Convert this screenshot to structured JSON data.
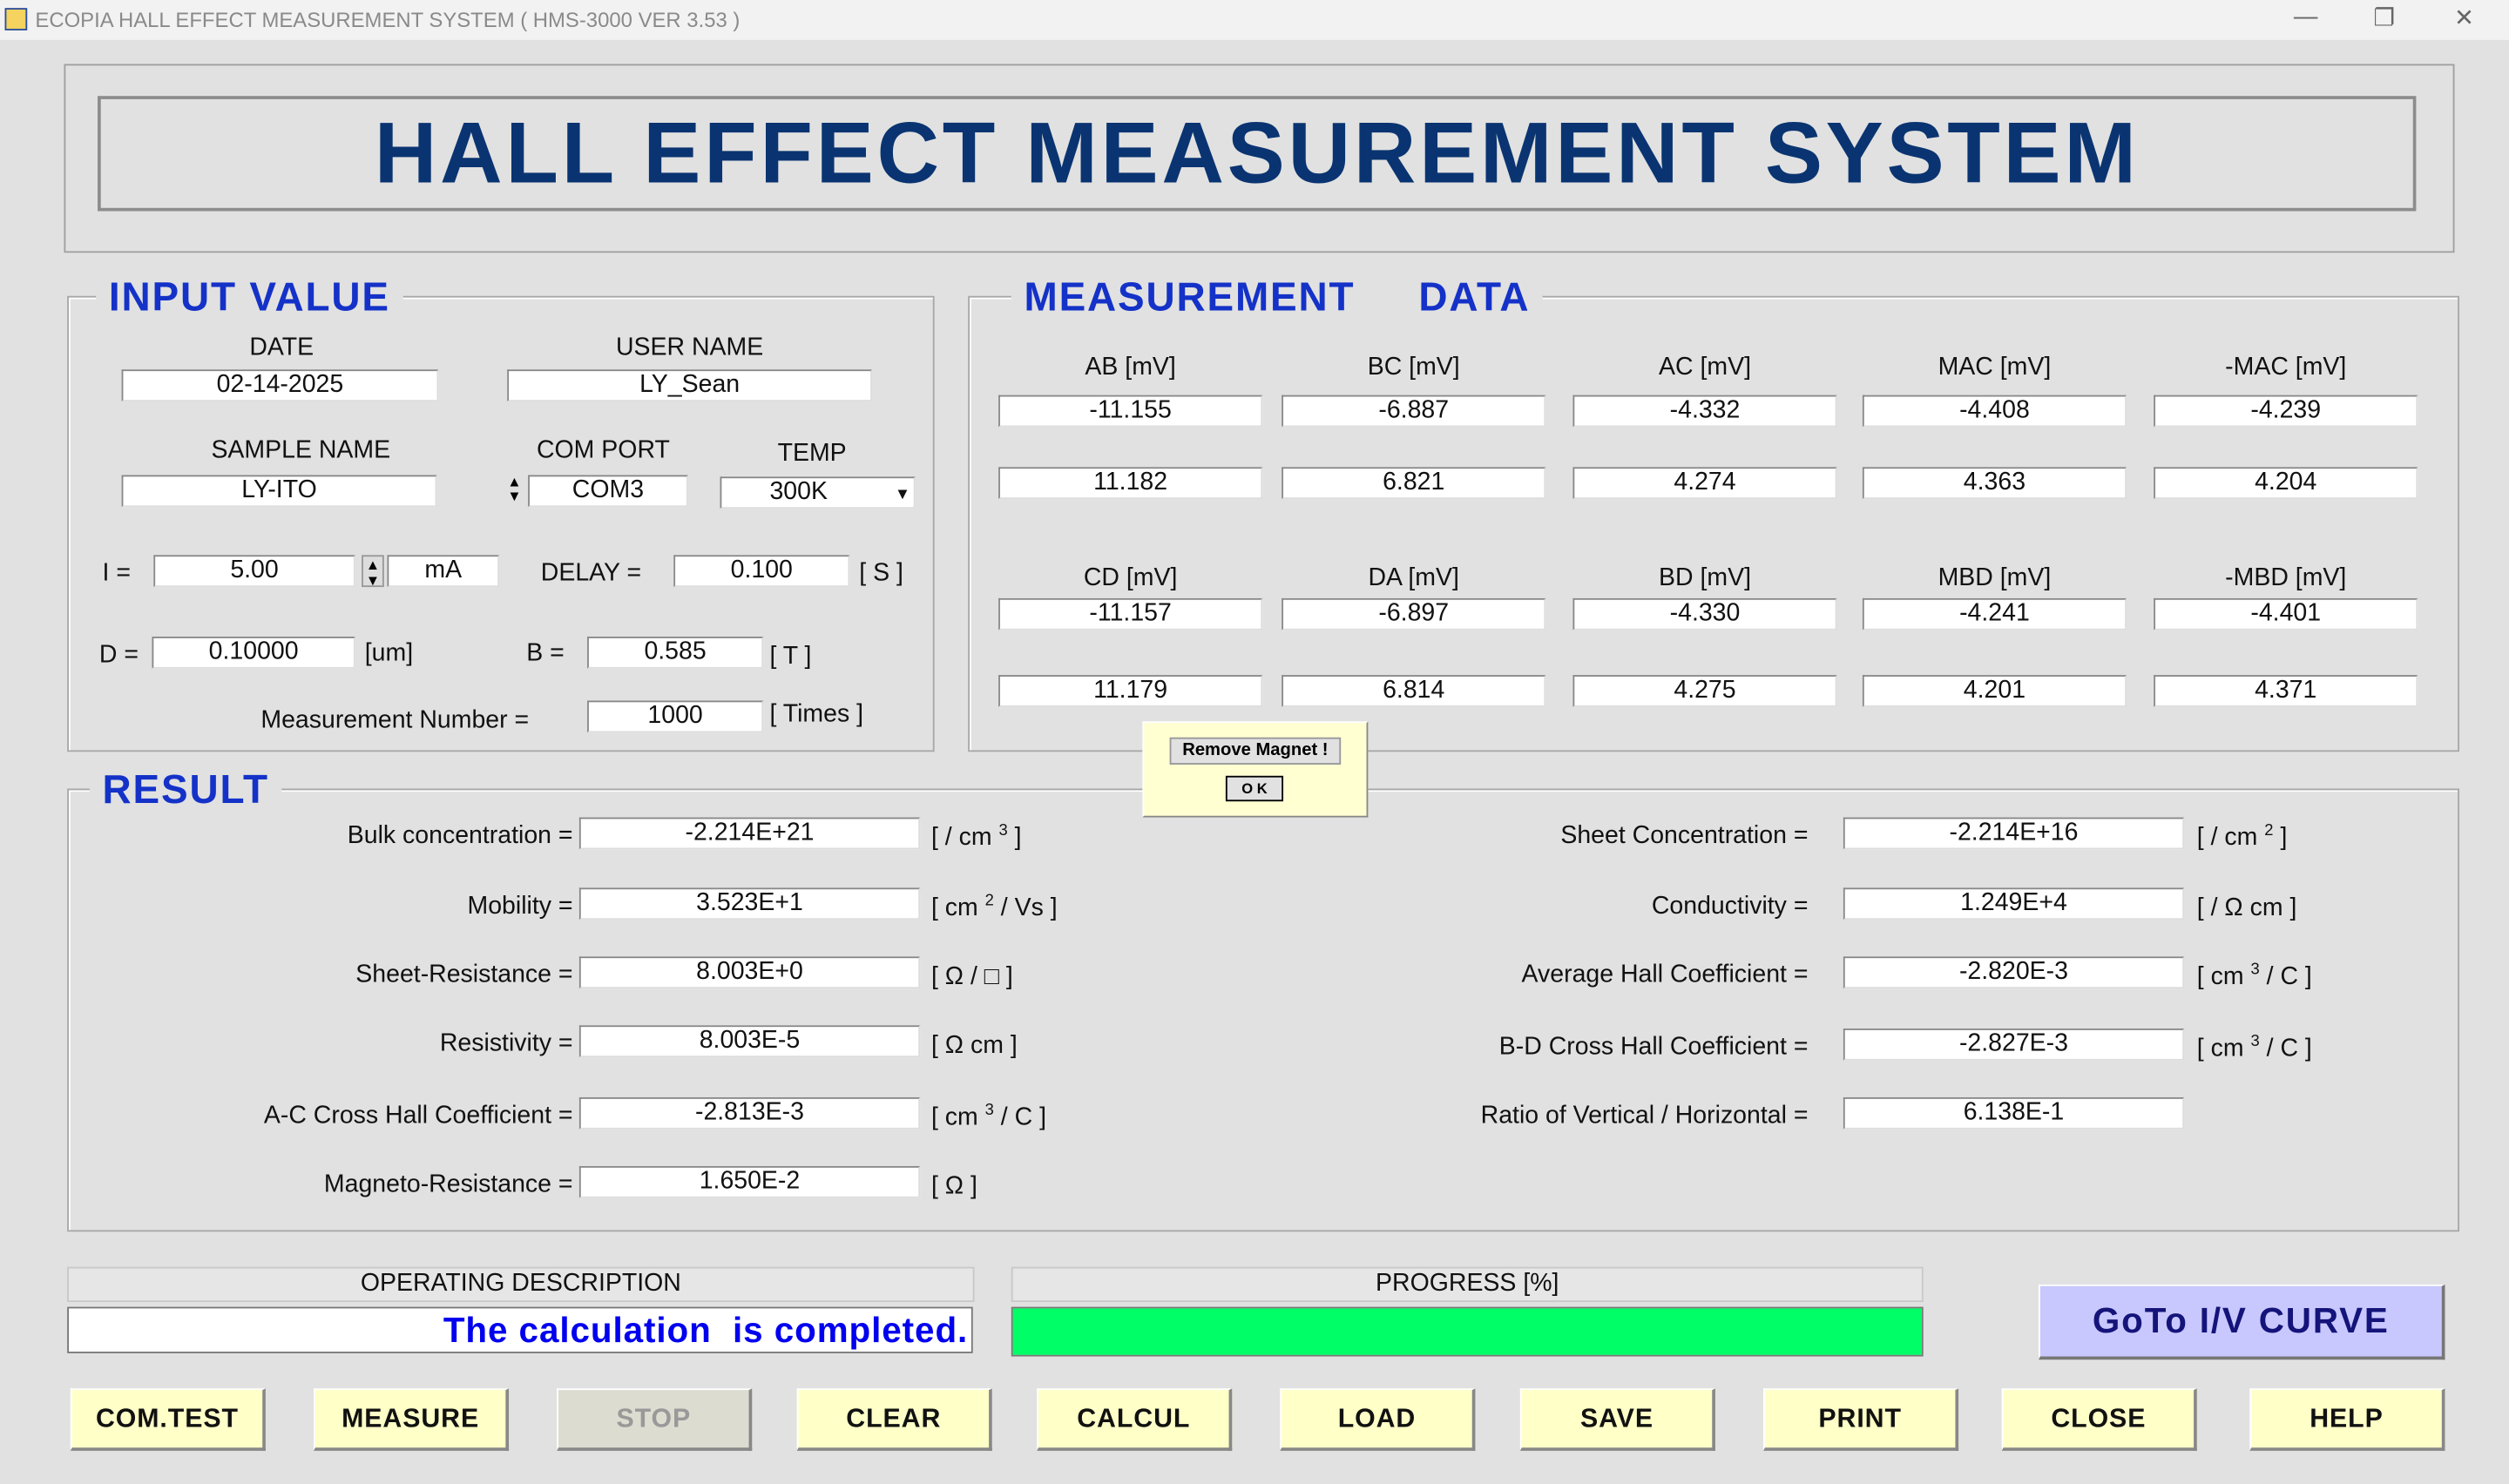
{
  "window": {
    "title": "ECOPIA HALL EFFECT MEASUREMENT SYSTEM ( HMS-3000  VER 3.53 )",
    "minimize": "—",
    "restore": "❐",
    "close": "✕"
  },
  "banner": "HALL EFFECT MEASUREMENT SYSTEM",
  "input": {
    "title": "INPUT VALUE",
    "date_label": "DATE",
    "date": "02-14-2025",
    "user_label": "USER NAME",
    "user": "LY_Sean",
    "sample_label": "SAMPLE NAME",
    "sample": "LY-ITO",
    "com_label": "COM PORT",
    "com": "COM3",
    "temp_label": "TEMP",
    "temp": "300K",
    "i_label": "I  =",
    "i": "5.00",
    "i_unit": "mA",
    "delay_label": "DELAY =",
    "delay": "0.100",
    "delay_unit": "[ S ]",
    "d_label": "D =",
    "d": "0.10000",
    "d_unit": "[um]",
    "b_label": "B =",
    "b": "0.585",
    "b_unit": "[ T ]",
    "num_label": "Measurement Number  =",
    "num": "1000",
    "num_unit": "[ Times ]"
  },
  "measurement": {
    "title": "MEASUREMENT     DATA",
    "headers1": [
      "AB [mV]",
      "BC [mV]",
      "AC [mV]",
      "MAC [mV]",
      "-MAC [mV]"
    ],
    "row1": [
      "-11.155",
      "-6.887",
      "-4.332",
      "-4.408",
      "-4.239"
    ],
    "row2": [
      "11.182",
      "6.821",
      "4.274",
      "4.363",
      "4.204"
    ],
    "headers2": [
      "CD [mV]",
      "DA [mV]",
      "BD [mV]",
      "MBD [mV]",
      "-MBD [mV]"
    ],
    "row3": [
      "-11.157",
      "-6.897",
      "-4.330",
      "-4.241",
      "-4.401"
    ],
    "row4": [
      "11.179",
      "6.814",
      "4.275",
      "4.201",
      "4.371"
    ]
  },
  "popup": {
    "message": "Remove Magnet !",
    "ok": "O K"
  },
  "result": {
    "title": "RESULT",
    "left": [
      {
        "label": "Bulk concentration =",
        "value": "-2.214E+21",
        "unit": "[ / cm",
        "sup": "3",
        "unit2": "]"
      },
      {
        "label": "Mobility =",
        "value": "3.523E+1",
        "unit": "[ cm",
        "sup": "2",
        "unit2": "/  Vs ]"
      },
      {
        "label": "Sheet-Resistance =",
        "value": "8.003E+0",
        "unit": "[ Ω  /  □ ]",
        "sup": "",
        "unit2": ""
      },
      {
        "label": "Resistivity =",
        "value": "8.003E-5",
        "unit": "[ Ω cm ]",
        "sup": "",
        "unit2": ""
      },
      {
        "label": "A-C Cross Hall Coefficient =",
        "value": "-2.813E-3",
        "unit": "[ cm",
        "sup": "3",
        "unit2": "/ C ]"
      },
      {
        "label": "Magneto-Resistance =",
        "value": "1.650E-2",
        "unit": "[ Ω ]",
        "sup": "",
        "unit2": ""
      }
    ],
    "right": [
      {
        "label": "Sheet Concentration =",
        "value": "-2.214E+16",
        "unit": "[ / cm",
        "sup": "2",
        "unit2": "]"
      },
      {
        "label": "Conductivity =",
        "value": "1.249E+4",
        "unit": "[ /  Ω  cm ]",
        "sup": "",
        "unit2": ""
      },
      {
        "label": "Average Hall Coefficient =",
        "value": "-2.820E-3",
        "unit": "[ cm",
        "sup": "3",
        "unit2": "/ C ]"
      },
      {
        "label": "B-D Cross Hall Coefficient =",
        "value": "-2.827E-3",
        "unit": "[ cm",
        "sup": "3",
        "unit2": "/ C ]"
      },
      {
        "label": "Ratio of Vertical / Horizontal =",
        "value": "6.138E-1",
        "unit": "",
        "sup": "",
        "unit2": ""
      }
    ]
  },
  "status": {
    "op_header": "OPERATING    DESCRIPTION",
    "op_text": "The calculation  is completed.",
    "progress_header": "PROGRESS [%]",
    "progress": 100,
    "progress_color": "#00ff66"
  },
  "goto_iv": "GoTo I/V CURVE",
  "buttons": [
    "COM.TEST",
    "MEASURE",
    "STOP",
    "CLEAR",
    "CALCUL",
    "LOAD",
    "SAVE",
    "PRINT",
    "CLOSE",
    "HELP"
  ]
}
